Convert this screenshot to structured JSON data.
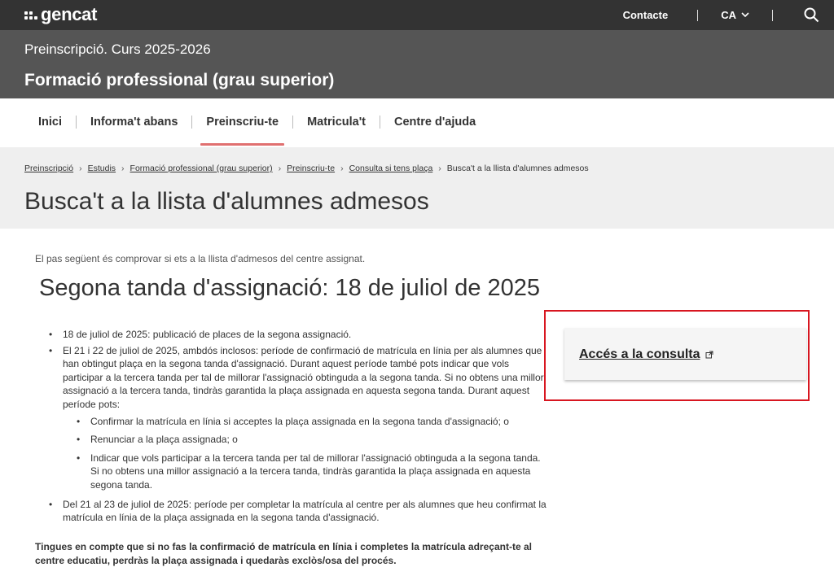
{
  "header": {
    "logo_text": "gencat",
    "contact_label": "Contacte",
    "language": "CA",
    "icons": [
      "chevron-down-icon",
      "search-icon"
    ]
  },
  "title_band": {
    "subtitle": "Preinscripció. Curs 2025-2026",
    "title": "Formació professional (grau superior)"
  },
  "nav": {
    "items": [
      {
        "label": "Inici",
        "active": false
      },
      {
        "label": "Informa't abans",
        "active": false
      },
      {
        "label": "Preinscriu-te",
        "active": true
      },
      {
        "label": "Matricula't",
        "active": false
      },
      {
        "label": "Centre d'ajuda",
        "active": false
      }
    ]
  },
  "breadcrumb": {
    "items": [
      "Preinscripció",
      "Estudis",
      "Formació professional (grau superior)",
      "Preinscriu-te",
      "Consulta si tens plaça"
    ],
    "current": "Busca't a la llista d'alumnes admesos"
  },
  "page": {
    "title": "Busca't a la llista d'alumnes admesos",
    "intro": "El pas següent és comprovar si ets a la llista d'admesos del centre assignat.",
    "section_title": "Segona tanda d'assignació: 18 de juliol de 2025",
    "bullets": [
      "18 de juliol de 2025: publicació de places de la segona assignació.",
      "El 21 i 22 de juliol de 2025, ambdós inclosos: període de confirmació de matrícula en línia per als alumnes que han obtingut plaça en la segona tanda d'assignació. Durant aquest període també pots indicar que vols participar a la tercera tanda per tal de millorar l'assignació obtinguda a la segona tanda. Si no obtens una millor assignació a la tercera tanda, tindràs garantida la plaça assignada en aquesta segona tanda. Durant aquest període pots:",
      "Del 21 al 23 de juliol de 2025: període per completar la matrícula al centre per als alumnes que heu confirmat la matrícula en línia de la plaça assignada en la segona tanda d'assignació."
    ],
    "sub_bullets": [
      "Confirmar la matrícula en línia si acceptes la plaça assignada en la segona tanda d'assignació; o",
      "Renunciar a la plaça assignada; o",
      "Indicar que vols participar a la tercera tanda per tal de millorar l'assignació obtinguda a la segona tanda. Si no obtens una millor assignació a la tercera tanda, tindràs garantida la plaça assignada en aquesta segona tanda."
    ],
    "note": "Tingues en compte que si no fas la confirmació de matrícula en línia i completes la matrícula adreçant-te al centre educatiu, perdràs la plaça assignada i quedaràs exclòs/osa del procés."
  },
  "access_card": {
    "link_label": "Accés a la consulta",
    "icon": "external-link-icon",
    "highlight_color": "#d81620"
  },
  "colors": {
    "topbar": "#333333",
    "titleband": "#555555",
    "nav_active_underline": "#e07070",
    "crumb_background": "#efefef"
  }
}
